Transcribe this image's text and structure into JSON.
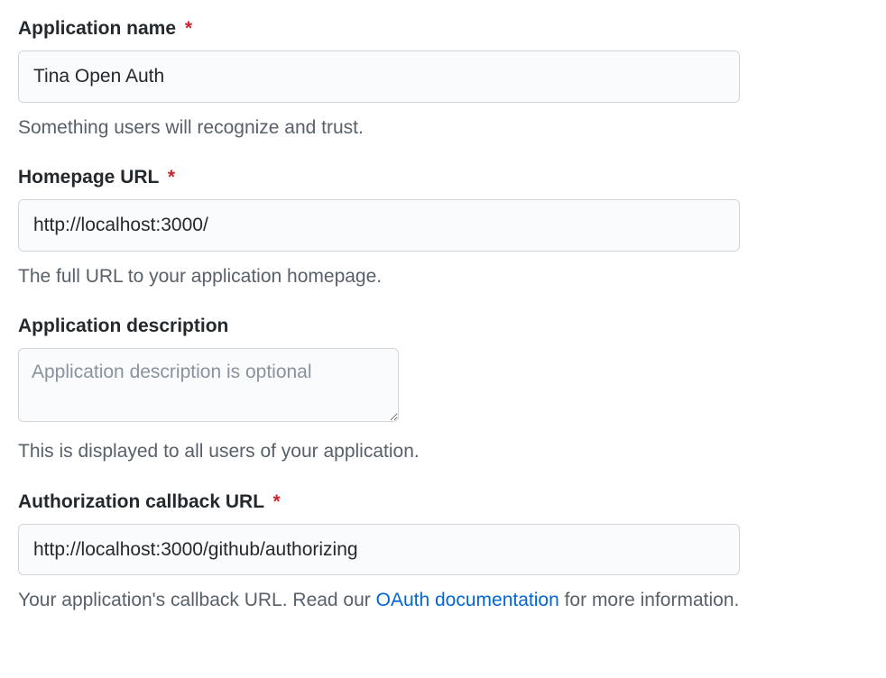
{
  "fields": {
    "appName": {
      "label": "Application name",
      "required": true,
      "value": "Tina Open Auth",
      "hint": "Something users will recognize and trust."
    },
    "homepageUrl": {
      "label": "Homepage URL",
      "required": true,
      "value": "http://localhost:3000/",
      "hint": "The full URL to your application homepage."
    },
    "appDescription": {
      "label": "Application description",
      "required": false,
      "value": "",
      "placeholder": "Application description is optional",
      "hint": "This is displayed to all users of your application."
    },
    "callbackUrl": {
      "label": "Authorization callback URL",
      "required": true,
      "value": "http://localhost:3000/github/authorizing",
      "hintPrefix": "Your application's callback URL. Read our ",
      "hintLinkText": "OAuth documentation",
      "hintSuffix": " for more information."
    }
  },
  "requiredMark": "*"
}
